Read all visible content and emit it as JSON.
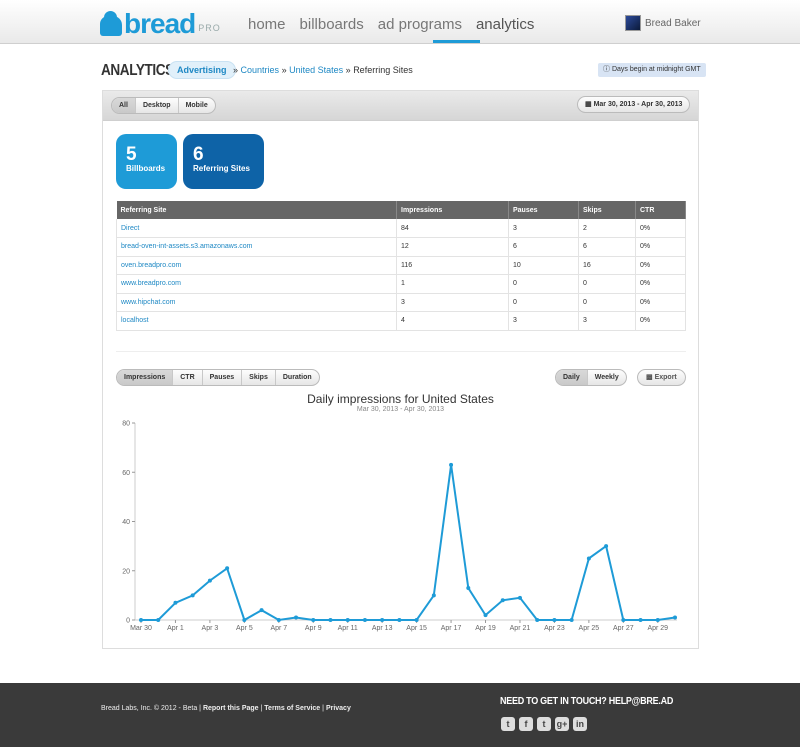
{
  "brand": {
    "name": "bread",
    "tier": "PRO"
  },
  "nav": {
    "items": [
      {
        "label": "home"
      },
      {
        "label": "billboards"
      },
      {
        "label": "ad programs"
      },
      {
        "label": "analytics"
      }
    ],
    "active": "analytics"
  },
  "user": {
    "name": "Bread Baker"
  },
  "page": {
    "title": "ANALYTICS",
    "breadcrumb": {
      "pill": "Advertising",
      "sep1": "»",
      "countries": "Countries",
      "sep2": "»",
      "country": "United States",
      "sep3": "»",
      "current": "Referring Sites"
    },
    "notice": {
      "icon": "info-icon",
      "text": "Days begin at midnight GMT"
    }
  },
  "filters": {
    "platforms": [
      "All",
      "Desktop",
      "Mobile"
    ],
    "selected_platform": "All",
    "date_range": "Mar 30, 2013 - Apr 30, 2013",
    "date_icon": "calendar-icon"
  },
  "stats": [
    {
      "value": "5",
      "label": "Billboards",
      "color": "#1e9bd7"
    },
    {
      "value": "6",
      "label": "Referring Sites",
      "color": "#0e63a7"
    }
  ],
  "table": {
    "columns": [
      "Referring Site",
      "Impressions",
      "Pauses",
      "Skips",
      "CTR"
    ],
    "rows": [
      [
        "Direct",
        "84",
        "3",
        "2",
        "0%"
      ],
      [
        "bread-oven-int-assets.s3.amazonaws.com",
        "12",
        "6",
        "6",
        "0%"
      ],
      [
        "oven.breadpro.com",
        "116",
        "10",
        "16",
        "0%"
      ],
      [
        "www.breadpro.com",
        "1",
        "0",
        "0",
        "0%"
      ],
      [
        "www.hipchat.com",
        "3",
        "0",
        "0",
        "0%"
      ],
      [
        "localhost",
        "4",
        "3",
        "3",
        "0%"
      ]
    ]
  },
  "metric_tabs": [
    "Impressions",
    "CTR",
    "Pauses",
    "Skips",
    "Duration"
  ],
  "selected_metric": "Impressions",
  "period_tabs": [
    "Daily",
    "Weekly"
  ],
  "selected_period": "Daily",
  "export": {
    "label": "Export",
    "icon": "chart-icon"
  },
  "accent_color": "#1e9bd7",
  "chart_data": {
    "type": "line",
    "title": "Daily impressions for United States",
    "subtitle": "Mar 30, 2013 - Apr 30, 2013",
    "xlabel": "",
    "ylabel": "",
    "ylim": [
      0,
      80
    ],
    "yticks": [
      0,
      20,
      40,
      60,
      80
    ],
    "tick_labels": [
      "Mar 30",
      "Apr 1",
      "Apr 3",
      "Apr 5",
      "Apr 7",
      "Apr 9",
      "Apr 11",
      "Apr 13",
      "Apr 15",
      "Apr 17",
      "Apr 19",
      "Apr 21",
      "Apr 23",
      "Apr 25",
      "Apr 27",
      "Apr 29"
    ],
    "categories": [
      "Mar 30",
      "Mar 31",
      "Apr 1",
      "Apr 2",
      "Apr 3",
      "Apr 4",
      "Apr 5",
      "Apr 6",
      "Apr 7",
      "Apr 8",
      "Apr 9",
      "Apr 10",
      "Apr 11",
      "Apr 12",
      "Apr 13",
      "Apr 14",
      "Apr 15",
      "Apr 16",
      "Apr 17",
      "Apr 18",
      "Apr 19",
      "Apr 20",
      "Apr 21",
      "Apr 22",
      "Apr 23",
      "Apr 24",
      "Apr 25",
      "Apr 26",
      "Apr 27",
      "Apr 28",
      "Apr 29",
      "Apr 30"
    ],
    "series": [
      {
        "color": "#1e9bd7",
        "values": [
          0,
          0,
          7,
          10,
          16,
          21,
          0,
          4,
          0,
          1,
          0,
          0,
          0,
          0,
          0,
          0,
          0,
          10,
          63,
          13,
          2,
          8,
          9,
          0,
          0,
          0,
          25,
          30,
          0,
          0,
          0,
          1
        ]
      }
    ],
    "grid": false,
    "legend": "none"
  },
  "footer": {
    "copyright": "Bread Labs, Inc. © 2012 - Beta |",
    "report": "Report this Page",
    "sep1": "|",
    "terms": "Terms of Service",
    "sep2": "|",
    "privacy": "Privacy",
    "contact": "NEED TO GET IN TOUCH? HELP@BRE.AD",
    "socials": [
      {
        "name": "twitter-icon",
        "glyph": "t"
      },
      {
        "name": "facebook-icon",
        "glyph": "f"
      },
      {
        "name": "tumblr-icon",
        "glyph": "t"
      },
      {
        "name": "google-plus-icon",
        "glyph": "g+"
      },
      {
        "name": "linkedin-icon",
        "glyph": "in"
      }
    ]
  }
}
